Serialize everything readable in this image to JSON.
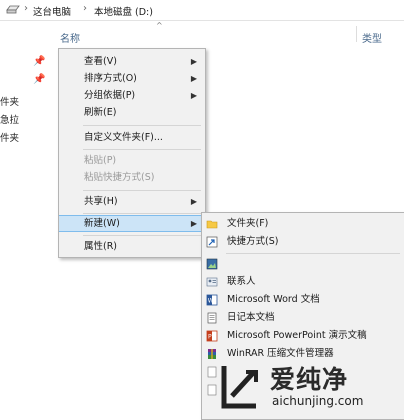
{
  "address_bar": {
    "crumbs": [
      "这台电脑",
      "本地磁盘 (D:)"
    ],
    "separator": "›"
  },
  "columns": {
    "name": "名称",
    "type": "类型",
    "sort_glyph": "^"
  },
  "left_pane": {
    "labels": [
      "件夹",
      "急拉",
      "件夹"
    ]
  },
  "context_menu": {
    "items": [
      {
        "label": "查看(V)",
        "submenu": true,
        "enabled": true
      },
      {
        "label": "排序方式(O)",
        "submenu": true,
        "enabled": true
      },
      {
        "label": "分组依据(P)",
        "submenu": true,
        "enabled": true
      },
      {
        "label": "刷新(E)",
        "submenu": false,
        "enabled": true
      },
      {
        "label": "自定义文件夹(F)...",
        "submenu": false,
        "enabled": true
      },
      {
        "label": "粘贴(P)",
        "submenu": false,
        "enabled": false
      },
      {
        "label": "粘贴快捷方式(S)",
        "submenu": false,
        "enabled": false
      },
      {
        "label": "共享(H)",
        "submenu": true,
        "enabled": true
      },
      {
        "label": "新建(W)",
        "submenu": true,
        "enabled": true,
        "highlighted": true
      },
      {
        "label": "属性(R)",
        "submenu": false,
        "enabled": true
      }
    ],
    "arrow": "▶"
  },
  "new_submenu": {
    "items": [
      {
        "label": "文件夹(F)",
        "icon": "folder-icon"
      },
      {
        "label": "快捷方式(S)",
        "icon": "shortcut-icon"
      },
      {
        "label": "",
        "icon": "bitmap-icon"
      },
      {
        "label": "联系人",
        "icon": "contact-icon"
      },
      {
        "label": "Microsoft Word 文档",
        "icon": "word-icon"
      },
      {
        "label": "日记本文档",
        "icon": "journal-icon"
      },
      {
        "label": "Microsoft PowerPoint 演示文稿",
        "icon": "powerpoint-icon"
      },
      {
        "label": "WinRAR 压缩文件管理器",
        "icon": "winrar-icon"
      }
    ]
  },
  "watermark": {
    "brand": "爱纯净",
    "domain": "aichunjing.com"
  }
}
